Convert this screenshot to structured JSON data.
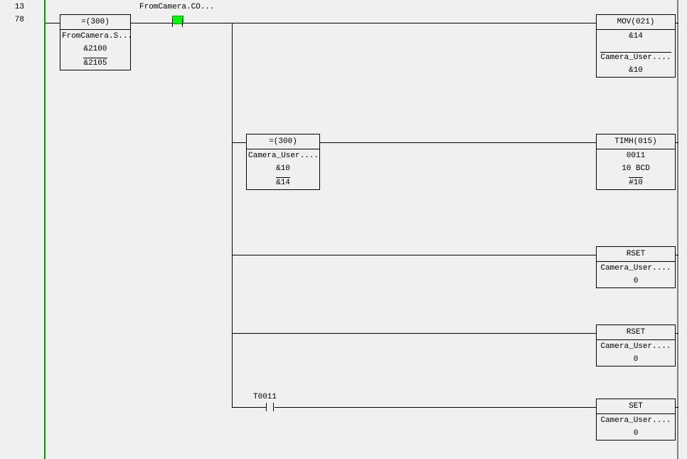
{
  "rung": {
    "index": "13",
    "address": "78"
  },
  "contact1": {
    "label": "FromCamera.CO..."
  },
  "contact2": {
    "label": "T0011"
  },
  "blocks": {
    "cmp1": {
      "title": "=(300)",
      "line1": "FromCamera.S...",
      "line2": "&2100",
      "line3": "&2105"
    },
    "cmp2": {
      "title": "=(300)",
      "line1": "Camera_User....",
      "line2": "&10",
      "line3": "&14"
    },
    "mov": {
      "title": "MOV(021)",
      "line1": "&14",
      "line2": "Camera_User....",
      "line3": "&10"
    },
    "timh": {
      "title": "TIMH(015)",
      "line1": "0011",
      "line2": "10 BCD",
      "line3": "#10"
    },
    "rset1": {
      "title": "RSET",
      "line1": "Camera_User....",
      "line2": "0"
    },
    "rset2": {
      "title": "RSET",
      "line1": "Camera_User....",
      "line2": "0"
    },
    "set": {
      "title": "SET",
      "line1": "Camera_User....",
      "line2": "0"
    }
  }
}
